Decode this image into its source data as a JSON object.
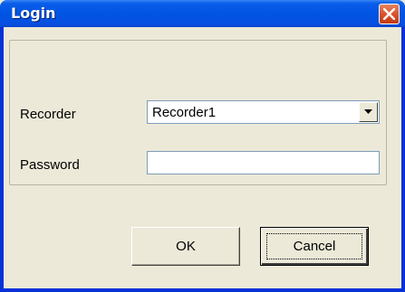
{
  "window": {
    "title": "Login",
    "close_icon": "close-icon"
  },
  "form": {
    "recorder_label": "Recorder",
    "recorder_value": "Recorder1",
    "password_label": "Password",
    "password_value": ""
  },
  "buttons": {
    "ok_label": "OK",
    "cancel_label": "Cancel"
  },
  "colors": {
    "titlebar": "#0054e3",
    "close_button": "#d7502a",
    "dialog_background": "#ece9d8"
  }
}
